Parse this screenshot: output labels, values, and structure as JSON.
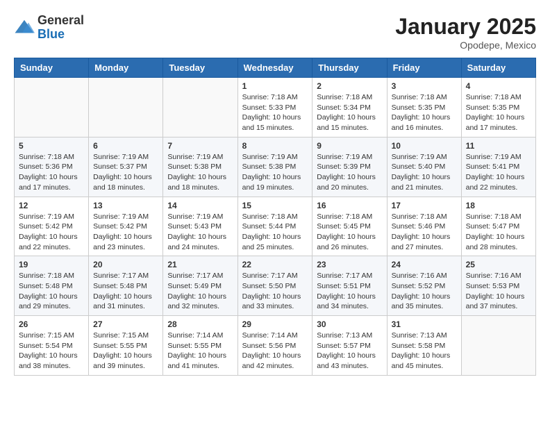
{
  "header": {
    "logo": {
      "general": "General",
      "blue": "Blue"
    },
    "title": "January 2025",
    "location": "Opodepe, Mexico"
  },
  "days_of_week": [
    "Sunday",
    "Monday",
    "Tuesday",
    "Wednesday",
    "Thursday",
    "Friday",
    "Saturday"
  ],
  "weeks": [
    [
      {
        "day": "",
        "info": ""
      },
      {
        "day": "",
        "info": ""
      },
      {
        "day": "",
        "info": ""
      },
      {
        "day": "1",
        "info": "Sunrise: 7:18 AM\nSunset: 5:33 PM\nDaylight: 10 hours\nand 15 minutes."
      },
      {
        "day": "2",
        "info": "Sunrise: 7:18 AM\nSunset: 5:34 PM\nDaylight: 10 hours\nand 15 minutes."
      },
      {
        "day": "3",
        "info": "Sunrise: 7:18 AM\nSunset: 5:35 PM\nDaylight: 10 hours\nand 16 minutes."
      },
      {
        "day": "4",
        "info": "Sunrise: 7:18 AM\nSunset: 5:35 PM\nDaylight: 10 hours\nand 17 minutes."
      }
    ],
    [
      {
        "day": "5",
        "info": "Sunrise: 7:18 AM\nSunset: 5:36 PM\nDaylight: 10 hours\nand 17 minutes."
      },
      {
        "day": "6",
        "info": "Sunrise: 7:19 AM\nSunset: 5:37 PM\nDaylight: 10 hours\nand 18 minutes."
      },
      {
        "day": "7",
        "info": "Sunrise: 7:19 AM\nSunset: 5:38 PM\nDaylight: 10 hours\nand 18 minutes."
      },
      {
        "day": "8",
        "info": "Sunrise: 7:19 AM\nSunset: 5:38 PM\nDaylight: 10 hours\nand 19 minutes."
      },
      {
        "day": "9",
        "info": "Sunrise: 7:19 AM\nSunset: 5:39 PM\nDaylight: 10 hours\nand 20 minutes."
      },
      {
        "day": "10",
        "info": "Sunrise: 7:19 AM\nSunset: 5:40 PM\nDaylight: 10 hours\nand 21 minutes."
      },
      {
        "day": "11",
        "info": "Sunrise: 7:19 AM\nSunset: 5:41 PM\nDaylight: 10 hours\nand 22 minutes."
      }
    ],
    [
      {
        "day": "12",
        "info": "Sunrise: 7:19 AM\nSunset: 5:42 PM\nDaylight: 10 hours\nand 22 minutes."
      },
      {
        "day": "13",
        "info": "Sunrise: 7:19 AM\nSunset: 5:42 PM\nDaylight: 10 hours\nand 23 minutes."
      },
      {
        "day": "14",
        "info": "Sunrise: 7:19 AM\nSunset: 5:43 PM\nDaylight: 10 hours\nand 24 minutes."
      },
      {
        "day": "15",
        "info": "Sunrise: 7:18 AM\nSunset: 5:44 PM\nDaylight: 10 hours\nand 25 minutes."
      },
      {
        "day": "16",
        "info": "Sunrise: 7:18 AM\nSunset: 5:45 PM\nDaylight: 10 hours\nand 26 minutes."
      },
      {
        "day": "17",
        "info": "Sunrise: 7:18 AM\nSunset: 5:46 PM\nDaylight: 10 hours\nand 27 minutes."
      },
      {
        "day": "18",
        "info": "Sunrise: 7:18 AM\nSunset: 5:47 PM\nDaylight: 10 hours\nand 28 minutes."
      }
    ],
    [
      {
        "day": "19",
        "info": "Sunrise: 7:18 AM\nSunset: 5:48 PM\nDaylight: 10 hours\nand 29 minutes."
      },
      {
        "day": "20",
        "info": "Sunrise: 7:17 AM\nSunset: 5:48 PM\nDaylight: 10 hours\nand 31 minutes."
      },
      {
        "day": "21",
        "info": "Sunrise: 7:17 AM\nSunset: 5:49 PM\nDaylight: 10 hours\nand 32 minutes."
      },
      {
        "day": "22",
        "info": "Sunrise: 7:17 AM\nSunset: 5:50 PM\nDaylight: 10 hours\nand 33 minutes."
      },
      {
        "day": "23",
        "info": "Sunrise: 7:17 AM\nSunset: 5:51 PM\nDaylight: 10 hours\nand 34 minutes."
      },
      {
        "day": "24",
        "info": "Sunrise: 7:16 AM\nSunset: 5:52 PM\nDaylight: 10 hours\nand 35 minutes."
      },
      {
        "day": "25",
        "info": "Sunrise: 7:16 AM\nSunset: 5:53 PM\nDaylight: 10 hours\nand 37 minutes."
      }
    ],
    [
      {
        "day": "26",
        "info": "Sunrise: 7:15 AM\nSunset: 5:54 PM\nDaylight: 10 hours\nand 38 minutes."
      },
      {
        "day": "27",
        "info": "Sunrise: 7:15 AM\nSunset: 5:55 PM\nDaylight: 10 hours\nand 39 minutes."
      },
      {
        "day": "28",
        "info": "Sunrise: 7:14 AM\nSunset: 5:55 PM\nDaylight: 10 hours\nand 41 minutes."
      },
      {
        "day": "29",
        "info": "Sunrise: 7:14 AM\nSunset: 5:56 PM\nDaylight: 10 hours\nand 42 minutes."
      },
      {
        "day": "30",
        "info": "Sunrise: 7:13 AM\nSunset: 5:57 PM\nDaylight: 10 hours\nand 43 minutes."
      },
      {
        "day": "31",
        "info": "Sunrise: 7:13 AM\nSunset: 5:58 PM\nDaylight: 10 hours\nand 45 minutes."
      },
      {
        "day": "",
        "info": ""
      }
    ]
  ]
}
